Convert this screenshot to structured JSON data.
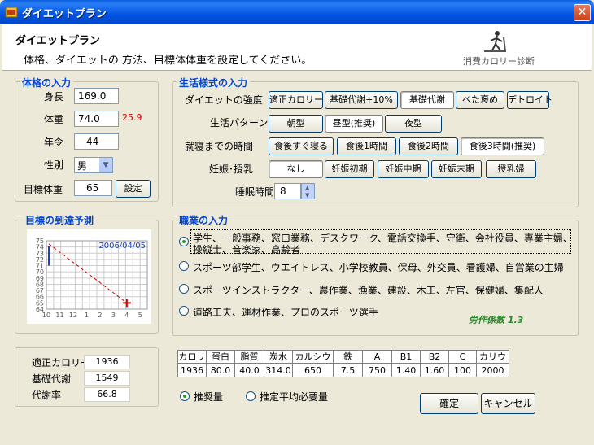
{
  "window": {
    "title": "ダイエットプラン",
    "close_symbol": "✕"
  },
  "header": {
    "title": "ダイエットプラン",
    "subtitle": "体格、ダイエットの 方法、目標体体重を設定してください。",
    "logo_text": "消費カロリー診断"
  },
  "body_input": {
    "title": "体格の入力",
    "height_label": "身長",
    "height_value": "169.0",
    "weight_label": "体重",
    "weight_value": "74.0",
    "bmi": "25.9",
    "age_label": "年令",
    "age_value": "44",
    "sex_label": "性別",
    "sex_value": "男",
    "target_label": "目標体重",
    "target_value": "65",
    "set_button": "設定"
  },
  "lifestyle": {
    "title": "生活様式の入力",
    "intensity_label": "ダイエットの強度",
    "intensity_options": [
      "適正カロリー",
      "基礎代謝+10%",
      "基礎代謝",
      "べた褒め",
      "デトロイト"
    ],
    "pattern_label": "生活パターン",
    "pattern_options": [
      "朝型",
      "昼型(推奨)",
      "夜型"
    ],
    "sleep_gap_label": "就寝までの時間",
    "sleep_gap_options": [
      "食後すぐ寝る",
      "食後1時間",
      "食後2時間",
      "食後3時間(推奨)"
    ],
    "pregnancy_label": "妊娠･授乳",
    "pregnancy_options": [
      "なし",
      "妊娠初期",
      "妊娠中期",
      "妊娠末期",
      "授乳婦"
    ],
    "sleep_hours_label": "睡眠時間",
    "sleep_hours_value": "8"
  },
  "prediction": {
    "title": "目標の到達予測",
    "date": "2006/04/05",
    "chart_data": {
      "type": "line",
      "title": "2006/04/05",
      "y_ticks": [
        "75",
        "74",
        "73",
        "72",
        "71",
        "70",
        "69",
        "68",
        "67",
        "66",
        "65",
        "64"
      ],
      "x_ticks": [
        "10",
        "11",
        "12",
        "1",
        "2",
        "3",
        "4",
        "5"
      ],
      "ylim": [
        64,
        75
      ],
      "series": [
        {
          "values": [
            {
              "x": "10",
              "y": 74.5
            },
            {
              "x": "4",
              "y": 65
            }
          ]
        }
      ],
      "marker": {
        "x": "4",
        "y": 65
      },
      "history": {
        "x": "10",
        "y_from": 71,
        "y_to": 74.2
      }
    }
  },
  "occupation": {
    "title": "職業の入力",
    "options": [
      "学生、一般事務、窓口業務、デスクワーク、電話交換手、守衛、会社役員、専業主婦、",
      "スポーツ部学生、ウエイトレス、小学校教員、保母、外交員、看護婦、自営業の主婦",
      "スポーツインストラクター、農作業、漁業、建設、木工、左官、保健婦、集配人",
      "道路工夫、運材作業、プロのスポーツ選手"
    ],
    "option1_line2": "操縦士、音楽家、高齢者",
    "selected": 0,
    "coef_label": "労作係数 1.3"
  },
  "summary": {
    "rows": [
      {
        "label": "適正カロリー",
        "value": "1936"
      },
      {
        "label": "基礎代謝",
        "value": "1549"
      },
      {
        "label": "代謝率",
        "value": "66.8"
      }
    ]
  },
  "nutrition": {
    "headers": [
      "カロリー",
      "蛋白",
      "脂質",
      "炭水",
      "カルシウム",
      "鉄",
      "A",
      "B1",
      "B2",
      "C",
      "カリウム"
    ],
    "values": [
      "1936",
      "80.0",
      "40.0",
      "314.0",
      "650",
      "7.5",
      "750",
      "1.40",
      "1.60",
      "100",
      "2000"
    ]
  },
  "mode": {
    "recommended": "推奨量",
    "average": "推定平均必要量"
  },
  "buttons": {
    "ok": "確定",
    "cancel": "キャンセル"
  },
  "colors": {
    "accent": "#0046d5",
    "bmi": "#d40000",
    "coef": "#2a8a2a",
    "chart_line": "#d40000"
  }
}
